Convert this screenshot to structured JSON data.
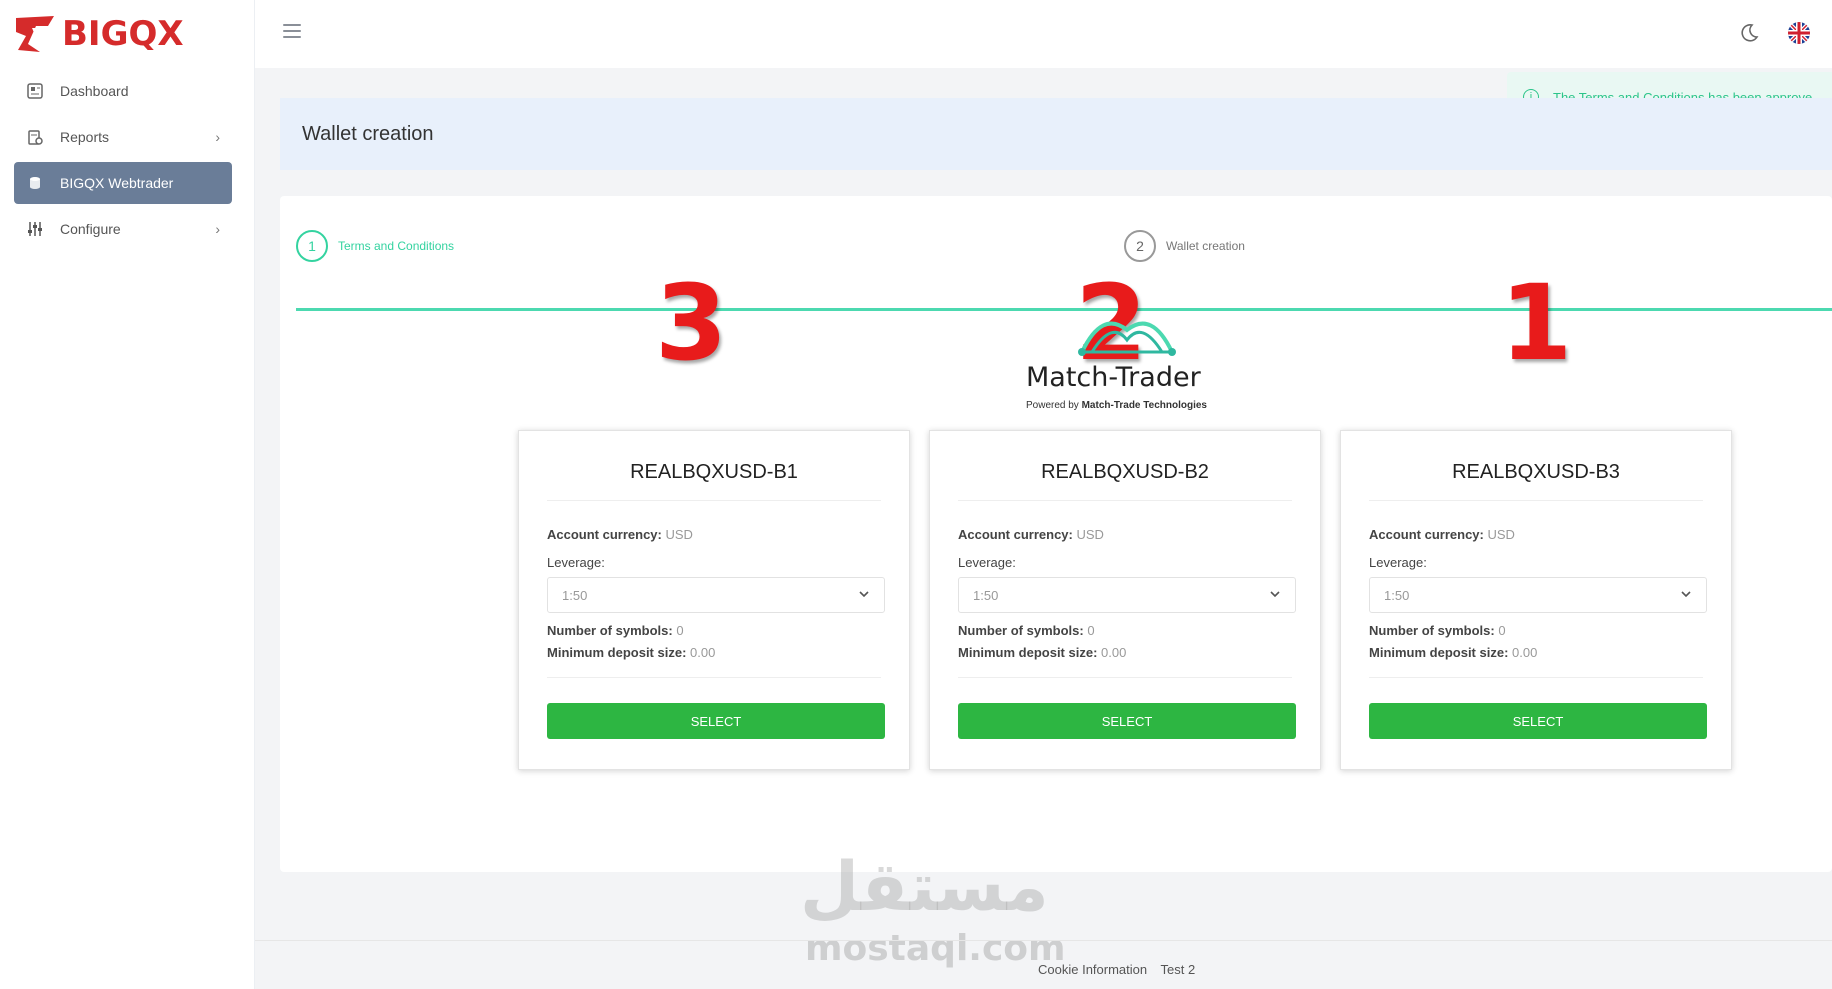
{
  "brand": {
    "name": "BIGQX",
    "color": "#d52b2b"
  },
  "sidebar": {
    "items": [
      {
        "label": "Dashboard",
        "icon": "dashboard-icon",
        "has_children": false
      },
      {
        "label": "Reports",
        "icon": "reports-icon",
        "has_children": true
      },
      {
        "label": "BIGQX Webtrader",
        "icon": "webtrader-icon",
        "has_children": false,
        "active": true
      },
      {
        "label": "Configure",
        "icon": "sliders-icon",
        "has_children": true
      }
    ]
  },
  "toast": {
    "text": "The Terms and Conditions has been approve",
    "color": "#2bc48a"
  },
  "page": {
    "title": "Wallet creation"
  },
  "steps": [
    {
      "number": "1",
      "label": "Terms and Conditions"
    },
    {
      "number": "2",
      "label": "Wallet creation"
    }
  ],
  "annotations": {
    "n3": "3",
    "n2": "2",
    "n1": "1"
  },
  "platform_logo": {
    "name": "Match-Trader",
    "subtitle_prefix": "Powered by",
    "subtitle_company": "Match-Trade Technologies"
  },
  "accounts": [
    {
      "name": "REALBQXUSD-B1",
      "currency_label": "Account currency:",
      "currency": "USD",
      "leverage_label": "Leverage:",
      "leverage": "1:50",
      "symbols_label": "Number of symbols:",
      "symbols": "0",
      "deposit_label": "Minimum deposit size:",
      "deposit": "0.00",
      "button": "SELECT"
    },
    {
      "name": "REALBQXUSD-B2",
      "currency_label": "Account currency:",
      "currency": "USD",
      "leverage_label": "Leverage:",
      "leverage": "1:50",
      "symbols_label": "Number of symbols:",
      "symbols": "0",
      "deposit_label": "Minimum deposit size:",
      "deposit": "0.00",
      "button": "SELECT"
    },
    {
      "name": "REALBQXUSD-B3",
      "currency_label": "Account currency:",
      "currency": "USD",
      "leverage_label": "Leverage:",
      "leverage": "1:50",
      "symbols_label": "Number of symbols:",
      "symbols": "0",
      "deposit_label": "Minimum deposit size:",
      "deposit": "0.00",
      "button": "SELECT"
    }
  ],
  "watermark": {
    "arabic": "مستقل",
    "latin": "mostaql.com"
  },
  "footer": {
    "links": [
      "Cookie Information",
      "Test 2"
    ]
  },
  "colors": {
    "accent": "#4cd9b0",
    "select_button": "#2db642",
    "active_nav": "#6a7d98",
    "annotation": "#e81b1b"
  }
}
